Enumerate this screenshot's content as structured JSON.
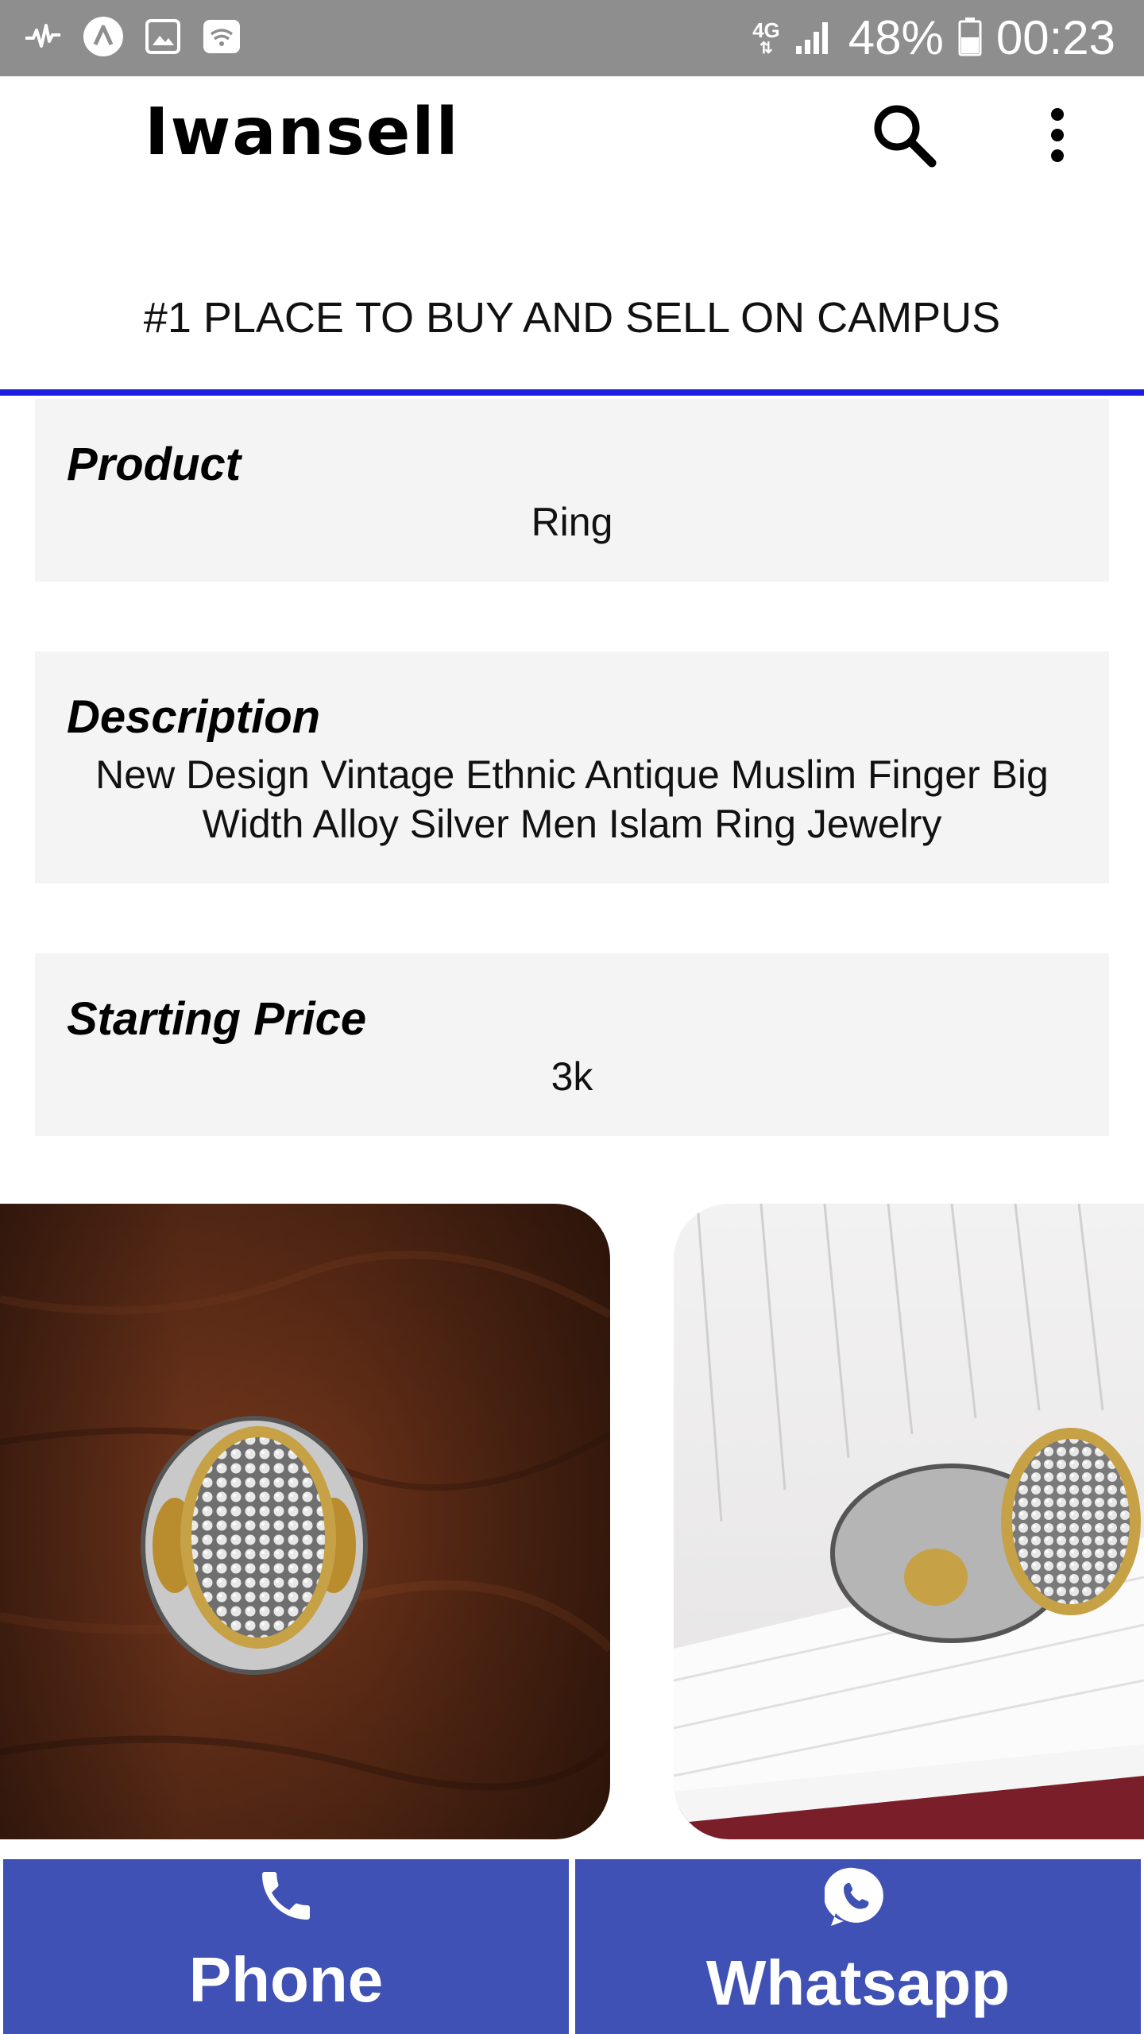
{
  "status_bar": {
    "network": "4G",
    "battery": "48%",
    "time": "00:23",
    "icons": [
      "pulse-icon",
      "app-icon",
      "image-icon",
      "wifi-icon",
      "signal-icon",
      "battery-icon"
    ]
  },
  "app_bar": {
    "title": "Iwansell",
    "actions": [
      "search-icon",
      "more-vert-icon"
    ]
  },
  "tagline": "#1 PLACE TO BUY AND SELL ON CAMPUS",
  "details": {
    "product_label": "Product",
    "product_value": "Ring",
    "description_label": "Description",
    "description_value": "New Design Vintage Ethnic Antique  Muslim Finger Big Width Alloy Silver Men Islam Ring Jewelry",
    "price_label": "Starting Price",
    "price_value": "3k"
  },
  "photos": [
    "ring-on-wood-photo",
    "ring-on-notebook-photo"
  ],
  "actions": {
    "phone_label": "Phone",
    "whatsapp_label": "Whatsapp"
  },
  "colors": {
    "status_bar": "#8e8e8e",
    "accent_line": "#1d1de0",
    "card_background": "#f4f4f4",
    "action_button": "#3f51b5"
  }
}
